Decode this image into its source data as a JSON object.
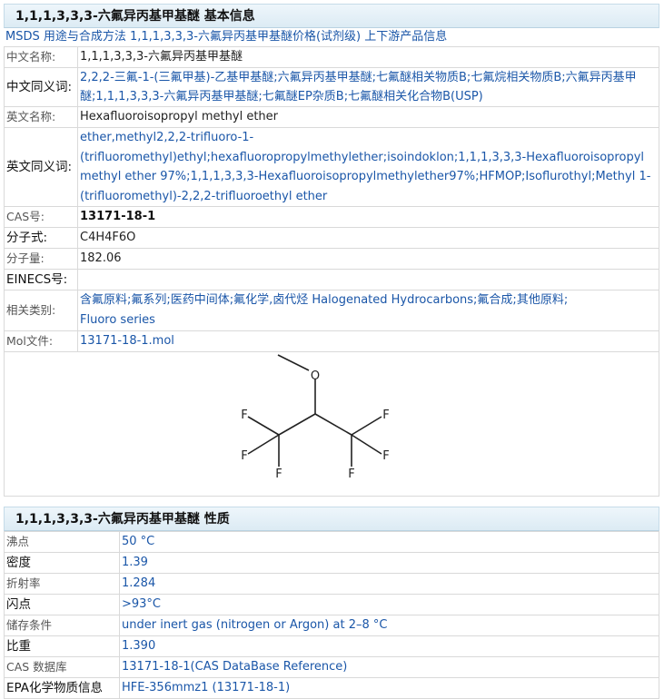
{
  "basic": {
    "title": "1,1,1,3,3,3-六氟异丙基甲基醚 基本信息",
    "links": "MSDS 用途与合成方法 1,1,1,3,3,3-六氟异丙基甲基醚价格(试剂级) 上下游产品信息",
    "rows": [
      {
        "label": "中文名称:",
        "value": "1,1,1,3,3,3-六氟异丙基甲基醚"
      },
      {
        "label": "中文同义词:",
        "value": "2,2,2-三氟-1-(三氟甲基)-乙基甲基醚;六氟异丙基甲基醚;七氟醚相关物质B;七氟烷相关物质B;六氟异丙基甲醚;1,1,1,3,3,3-六氟异丙基甲基醚;七氟醚EP杂质B;七氟醚相关化合物B(USP)"
      },
      {
        "label": "英文名称:",
        "value": "Hexafluoroisopropyl methyl ether"
      },
      {
        "label": "英文同义词:",
        "value": "ether,methyl2,2,2-trifluoro-1-(trifluoromethyl)ethyl;hexafluoropropylmethylether;isoindoklon;1,1,1,3,3,3-Hexafluoroisopropyl methyl ether 97%;1,1,1,3,3,3-Hexafluoroisopropylmethylether97%;HFMOP;Isoflurothyl;Methyl 1-(trifluoromethyl)-2,2,2-trifluoroethyl ether"
      },
      {
        "label": "CAS号:",
        "value": "13171-18-1"
      },
      {
        "label": "分子式:",
        "value": "C4H4F6O"
      },
      {
        "label": "分子量:",
        "value": "182.06"
      },
      {
        "label": "EINECS号:",
        "value": ""
      },
      {
        "label": "相关类别:",
        "value": "含氟原料;氟系列;医药中间体;氟化学,卤代烃 Halogenated Hydrocarbons;氟合成;其他原料;",
        "value2": "Fluoro series"
      },
      {
        "label": "Mol文件:",
        "value": "13171-18-1.mol"
      }
    ],
    "structure_atoms": {
      "o": "O",
      "f": "F"
    }
  },
  "props": {
    "title": "1,1,1,3,3,3-六氟异丙基甲基醚 性质",
    "rows": [
      {
        "label": "沸点",
        "value": "50 °C"
      },
      {
        "label": "密度",
        "value": "1.39"
      },
      {
        "label": "折射率",
        "value": "1.284"
      },
      {
        "label": "闪点",
        "value": ">93°C"
      },
      {
        "label": "储存条件",
        "value": "under inert gas (nitrogen or Argon) at 2–8 °C"
      },
      {
        "label": "比重",
        "value": "1.390"
      },
      {
        "label": "CAS 数据库",
        "value": "13171-18-1(CAS DataBase Reference)"
      },
      {
        "label": "EPA化学物质信息",
        "value": "HFE-356mmz1 (13171-18-1)"
      }
    ]
  },
  "colors": {
    "link": "#1a56a8",
    "header_bg": "#dcebf4",
    "border": "#d9d9d9"
  }
}
